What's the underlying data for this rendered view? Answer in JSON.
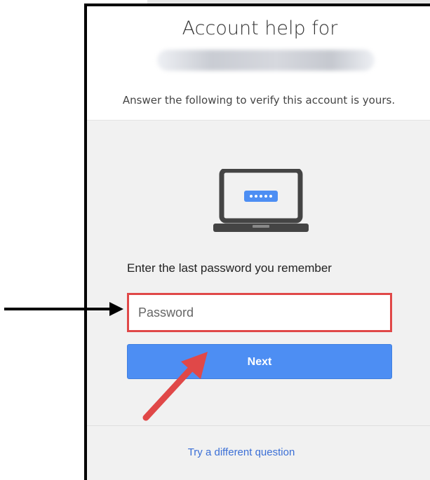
{
  "header": {
    "title": "Account help for",
    "subtitle": "Answer the following to verify this account is yours."
  },
  "challenge": {
    "prompt": "Enter the last password you remember",
    "password_placeholder": "Password",
    "next_label": "Next",
    "try_different_label": "Try a different question"
  },
  "colors": {
    "accent": "#4d8ef3",
    "input_highlight": "#e04848",
    "annotation_arrow_red": "#e04848",
    "annotation_arrow_black": "#000000",
    "link": "#3b6fd6"
  },
  "icons": {
    "device": "laptop-password-icon",
    "annotation_left": "black-arrow-icon",
    "annotation_button": "red-arrow-icon"
  }
}
